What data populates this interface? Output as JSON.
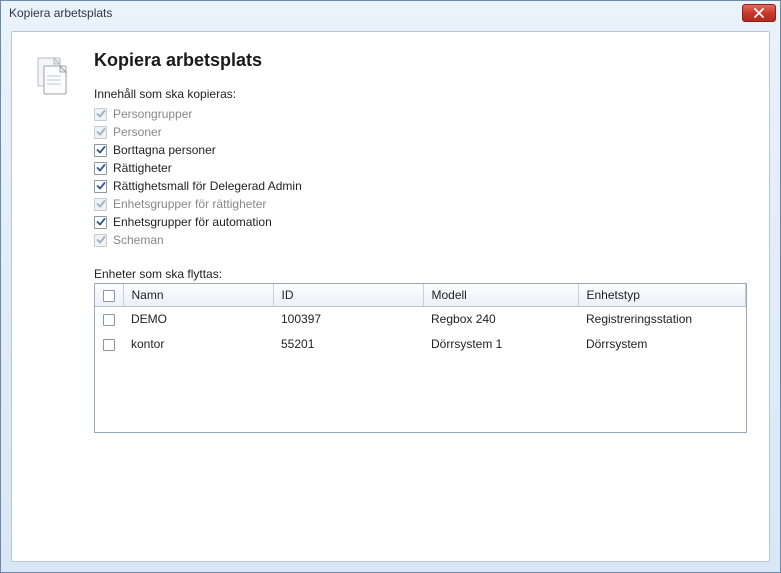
{
  "window": {
    "title": "Kopiera arbetsplats"
  },
  "heading": "Kopiera arbetsplats",
  "copy_section": {
    "label": "Innehåll som ska kopieras:",
    "items": [
      {
        "label": "Persongrupper",
        "checked": true,
        "enabled": false
      },
      {
        "label": "Personer",
        "checked": true,
        "enabled": false
      },
      {
        "label": "Borttagna personer",
        "checked": true,
        "enabled": true
      },
      {
        "label": "Rättigheter",
        "checked": true,
        "enabled": true
      },
      {
        "label": "Rättighetsmall för Delegerad Admin",
        "checked": true,
        "enabled": true
      },
      {
        "label": "Enhetsgrupper för rättigheter",
        "checked": true,
        "enabled": false
      },
      {
        "label": "Enhetsgrupper för automation",
        "checked": true,
        "enabled": true
      },
      {
        "label": "Scheman",
        "checked": true,
        "enabled": false
      }
    ]
  },
  "devices_section": {
    "label": "Enheter som ska flyttas:",
    "columns": {
      "name": "Namn",
      "id": "ID",
      "model": "Modell",
      "type": "Enhetstyp"
    },
    "rows": [
      {
        "name": "DEMO",
        "id": "100397",
        "model": "Regbox 240",
        "type": "Registreringsstation",
        "selected": false
      },
      {
        "name": "kontor",
        "id": "55201",
        "model": "Dörrsystem 1",
        "type": "Dörrsystem",
        "selected": false
      }
    ]
  }
}
